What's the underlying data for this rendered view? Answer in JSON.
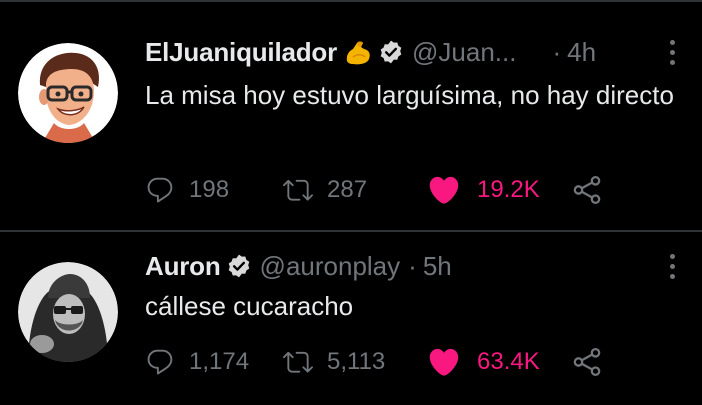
{
  "colors": {
    "background": "#000000",
    "text": "#e7e9ea",
    "muted": "#71767b",
    "like": "#f91880",
    "divider": "#2f3336",
    "verified_badge": "#d9d9d9"
  },
  "tweets": [
    {
      "display_name": "ElJuaniquilador",
      "emoji": "flexed-biceps",
      "verified": true,
      "handle": "@Juan...",
      "separator": "·",
      "time": "4h",
      "text": "La misa hoy estuvo larguísima, no hay directo",
      "avatar": "cartoon-man-with-glasses",
      "replies": "198",
      "retweets": "287",
      "likes": "19.2K",
      "liked": true
    },
    {
      "display_name": "Auron",
      "verified": true,
      "handle": "@auronplay",
      "separator": "·",
      "time": "5h",
      "text": "cállese cucaracho",
      "avatar": "grayscale-man-with-hood",
      "replies": "1,174",
      "retweets": "5,113",
      "likes": "63.4K",
      "liked": true
    }
  ],
  "icons": {
    "reply": "speech-bubble-icon",
    "retweet": "retweet-arrows-icon",
    "like": "heart-filled-icon",
    "share": "share-icon",
    "more": "vertical-ellipsis-icon"
  }
}
